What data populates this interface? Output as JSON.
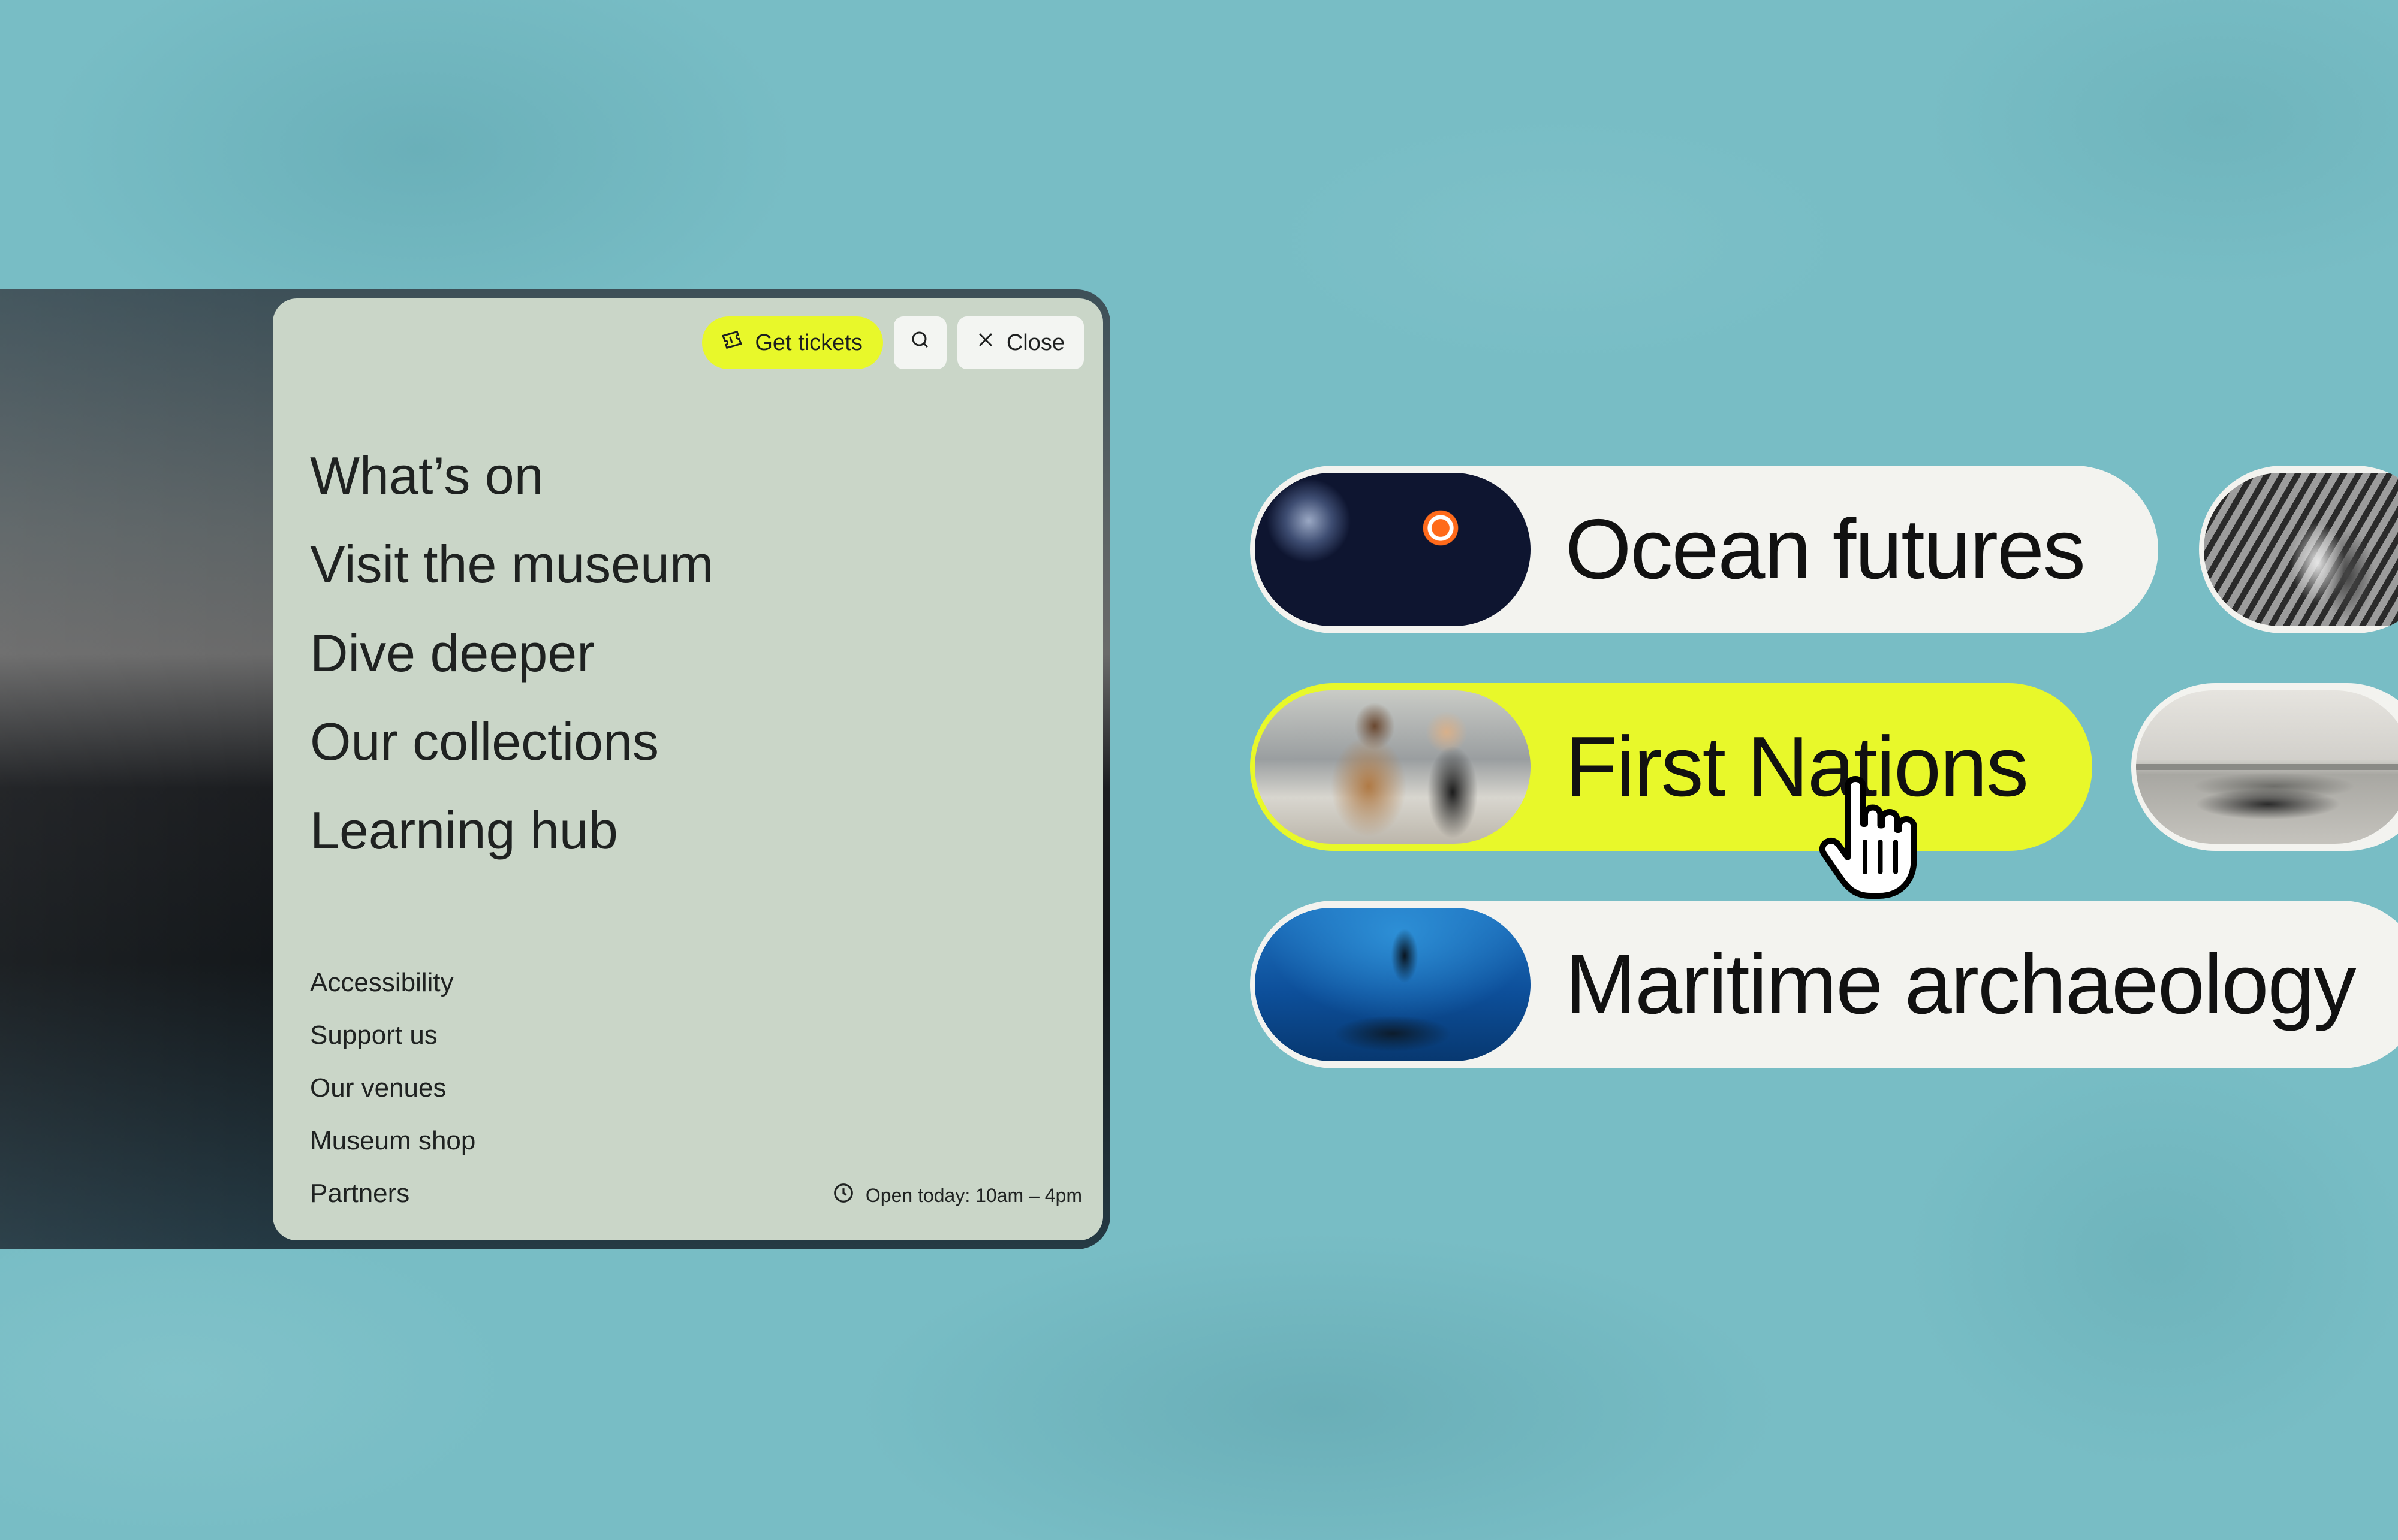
{
  "menu": {
    "get_tickets_label": "Get tickets",
    "close_label": "Close",
    "main_links": [
      "What’s on",
      "Visit the museum",
      "Dive deeper",
      "Our collections",
      "Learning hub"
    ],
    "secondary_links": [
      "Accessibility",
      "Support us",
      "Our venues",
      "Museum shop",
      "Partners"
    ],
    "hours": "Open today:  10am – 4pm"
  },
  "topics": [
    {
      "label": "Ocean futures",
      "image": "clownfish-anemone-photo",
      "active": false
    },
    {
      "label": "First Nations",
      "image": "people-on-wharf-photo",
      "active": true
    },
    {
      "label": "Maritime archaeology",
      "image": "diver-shipwreck-photo",
      "active": false
    }
  ],
  "partial_topics": [
    {
      "image": "historic-people-photo"
    },
    {
      "image": "historic-steamboat-photo"
    }
  ],
  "colors": {
    "background": "#78bdc5",
    "menu_panel": "#cad6c8",
    "accent": "#e8f82a",
    "pill": "#f3f3ef"
  },
  "icons": {
    "tickets": "ticket-icon",
    "search": "search-icon",
    "close": "close-icon",
    "hours": "clock-icon",
    "pointer": "hand-pointer-cursor"
  }
}
